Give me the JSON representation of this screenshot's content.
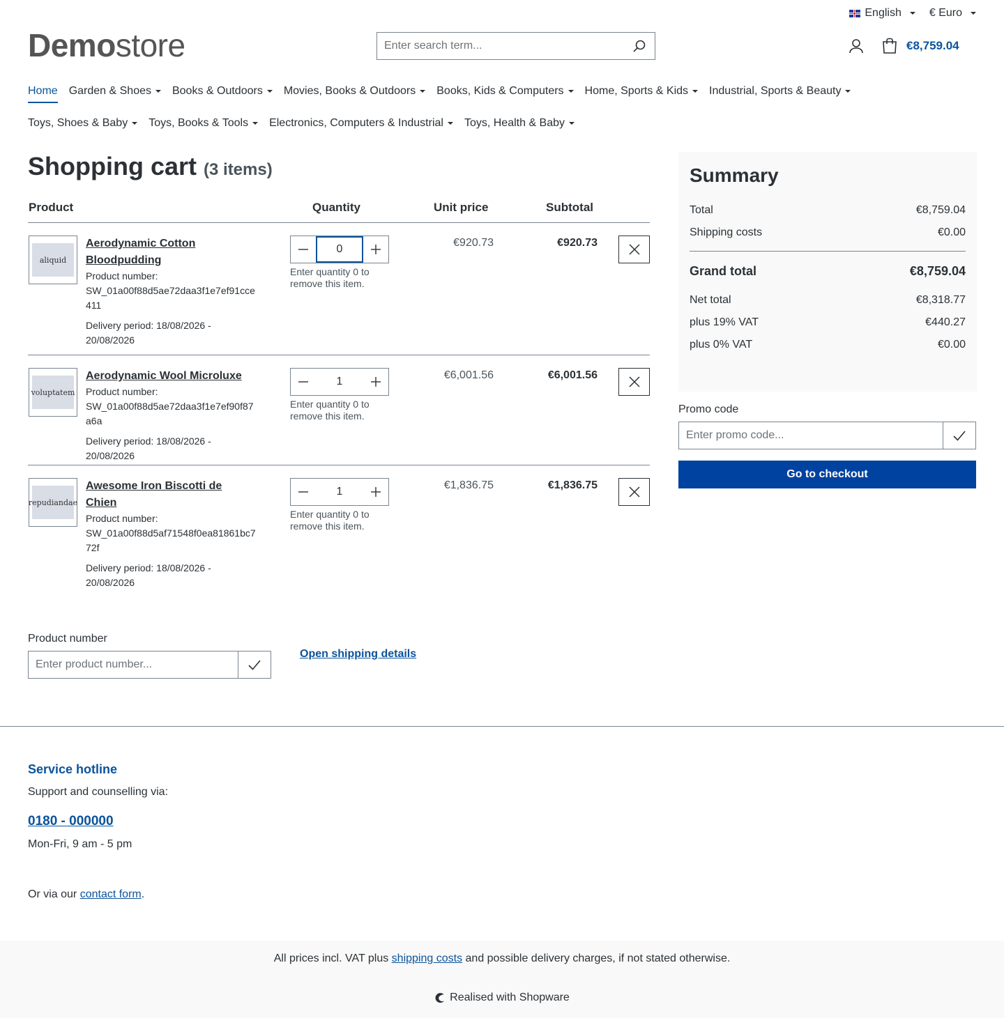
{
  "topbar": {
    "language": "English",
    "currency": "€ Euro"
  },
  "header": {
    "logo_bold": "Demo",
    "logo_light": "store",
    "search_placeholder": "Enter search term...",
    "cart_total": "€8,759.04"
  },
  "nav": [
    {
      "label": "Home",
      "active": true
    },
    {
      "label": "Garden & Shoes"
    },
    {
      "label": "Books & Outdoors"
    },
    {
      "label": "Movies, Books & Outdoors"
    },
    {
      "label": "Books, Kids & Computers"
    },
    {
      "label": "Home, Sports & Kids"
    },
    {
      "label": "Industrial, Sports & Beauty"
    },
    {
      "label": "Toys, Shoes & Baby"
    },
    {
      "label": "Toys, Books & Tools"
    },
    {
      "label": "Electronics, Computers & Industrial"
    },
    {
      "label": "Toys, Health & Baby"
    }
  ],
  "cart": {
    "title": "Shopping cart",
    "count": "(3 items)",
    "headers": {
      "product": "Product",
      "quantity": "Quantity",
      "unit_price": "Unit price",
      "subtotal": "Subtotal"
    },
    "items": [
      {
        "thumb_text": "aliquid",
        "name_line1": "Aerodynamic Cotton",
        "name_line2": "Bloodpudding",
        "number_label": "Product number:",
        "number": "SW_01a00f88d5ae72daa3f1e7ef91cce411",
        "delivery": "Delivery period: 18/08/2026 - 20/08/2026",
        "quantity": "0",
        "qty_hint": "Enter quantity 0 to remove this item.",
        "unit_price": "€920.73",
        "subtotal": "€920.73"
      },
      {
        "thumb_text": "voluptatem",
        "name_line1": "Aerodynamic Wool Microluxe",
        "name_line2": "",
        "number_label": "Product number:",
        "number": "SW_01a00f88d5ae72daa3f1e7ef90f87a6a",
        "delivery": "Delivery period: 18/08/2026 - 20/08/2026",
        "quantity": "1",
        "qty_hint": "Enter quantity 0 to remove this item.",
        "unit_price": "€6,001.56",
        "subtotal": "€6,001.56"
      },
      {
        "thumb_text": "repudiandae",
        "name_line1": "Awesome Iron Biscotti de",
        "name_line2": "Chien",
        "number_label": "Product number:",
        "number": "SW_01a00f88d5af71548f0ea81861bc772f",
        "delivery": "Delivery period: 18/08/2026 - 20/08/2026",
        "quantity": "1",
        "qty_hint": "Enter quantity 0 to remove this item.",
        "unit_price": "€1,836.75",
        "subtotal": "€1,836.75"
      }
    ],
    "add_product_label": "Product number",
    "add_product_placeholder": "Enter product number...",
    "shipping_link": "Open shipping details"
  },
  "summary": {
    "title": "Summary",
    "total_label": "Total",
    "total": "€8,759.04",
    "shipping_label": "Shipping costs",
    "shipping": "€0.00",
    "grand_label": "Grand total",
    "grand": "€8,759.04",
    "net_label": "Net total",
    "net": "€8,318.77",
    "vat19_label": "plus 19% VAT",
    "vat19": "€440.27",
    "vat0_label": "plus 0% VAT",
    "vat0": "€0.00",
    "promo_label": "Promo code",
    "promo_placeholder": "Enter promo code...",
    "checkout_label": "Go to checkout"
  },
  "footer": {
    "hotline_title": "Service hotline",
    "hotline_sub": "Support and counselling via:",
    "phone": "0180 - 000000",
    "hours": "Mon-Fri, 9 am - 5 pm",
    "contact_prefix": "Or via our",
    "contact_link": "contact form",
    "contact_suffix": ".",
    "vat_prefix": "All prices incl. VAT plus",
    "vat_link": "shipping costs",
    "vat_suffix": "and possible delivery charges, if not stated otherwise.",
    "realised": "Realised with Shopware"
  },
  "colors": {
    "accent": "#0b539b",
    "checkout": "#0042a0",
    "text": "#2b3136"
  }
}
